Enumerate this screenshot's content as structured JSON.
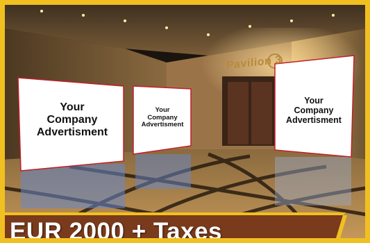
{
  "signage": {
    "pavilion_label": "Pavilion 3"
  },
  "ads": [
    {
      "text": "Your\nCompany\nAdvertisment"
    },
    {
      "text": "Your\nCompany\nAdvertisment"
    },
    {
      "text": "Your\nCompany\nAdvertisment"
    }
  ],
  "banner": {
    "price": "EUR 2000 + Taxes"
  },
  "colors": {
    "frame_border": "#f0c020",
    "banner_fill": "#7a3a1c",
    "banner_accent": "#f0c020",
    "ad_panel": "#ffffff",
    "ad_edge": "#c0202a"
  }
}
